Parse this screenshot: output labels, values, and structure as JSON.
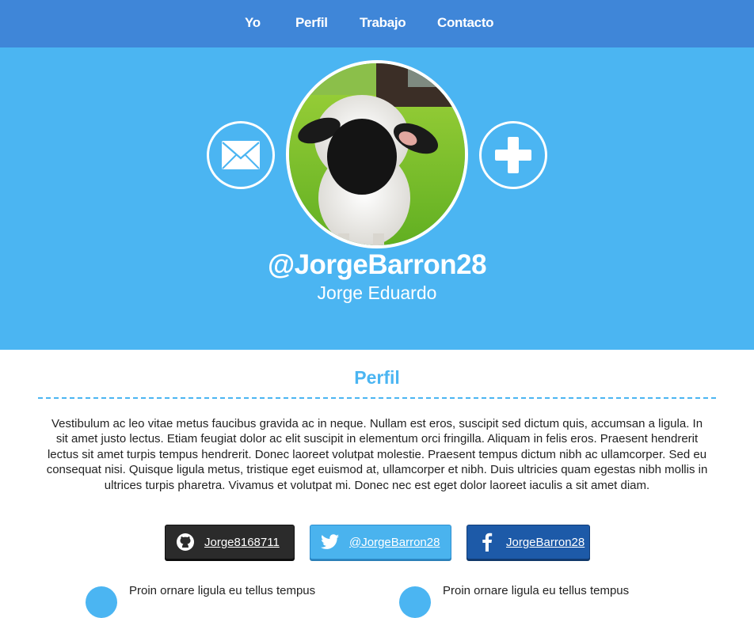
{
  "nav": {
    "items": [
      "Yo",
      "Perfil",
      "Trabajo",
      "Contacto"
    ]
  },
  "profile": {
    "handle": "@JorgeBarron28",
    "name": "Jorge Eduardo"
  },
  "section": {
    "title": "Perfil",
    "paragraph": "Vestibulum ac leo vitae metus faucibus gravida ac in neque. Nullam est eros, suscipit sed dictum quis, accumsan a ligula. In sit amet justo lectus. Etiam feugiat dolor ac elit suscipit in elementum orci fringilla. Aliquam in felis eros. Praesent hendrerit lectus sit amet turpis tempus hendrerit. Donec laoreet volutpat molestie. Praesent tempus dictum nibh ac ullamcorper. Sed eu consequat nisi. Quisque ligula metus, tristique eget euismod at, ullamcorper et nibh. Duis ultricies quam egestas nibh mollis in ultrices turpis pharetra. Vivamus et volutpat mi. Donec nec est eget dolor laoreet iaculis a sit amet diam."
  },
  "social": {
    "github": "Jorge8168711",
    "twitter": "@JorgeBarron28",
    "facebook": "JorgeBarron28"
  },
  "features": [
    "Proin ornare ligula eu tellus tempus",
    "Proin ornare ligula eu tellus tempus"
  ],
  "colors": {
    "nav": "#3f86d8",
    "hero": "#4bb5f2",
    "github": "#2b2b2b",
    "twitter": "#4ab3ee",
    "facebook": "#1d5aa8"
  },
  "icons": {
    "mail": "envelope-icon",
    "add": "plus-icon",
    "github": "github-icon",
    "twitter": "twitter-icon",
    "facebook": "facebook-icon"
  }
}
